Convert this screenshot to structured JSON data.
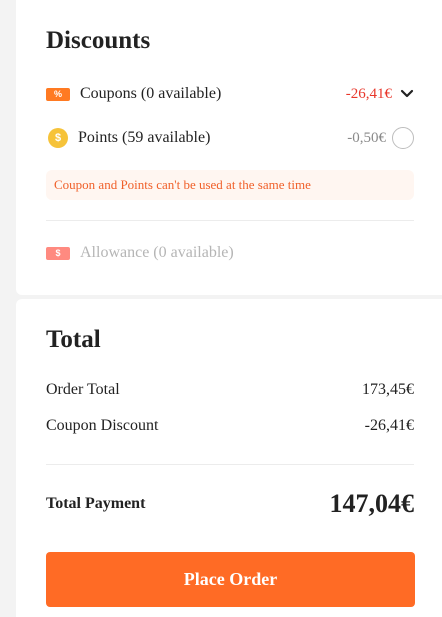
{
  "discounts": {
    "title": "Discounts",
    "coupons": {
      "icon_text": "%",
      "label": "Coupons (0 available)",
      "amount": "-26,41€",
      "amount_color": "#e8362a"
    },
    "points": {
      "icon_text": "$",
      "label": "Points (59 available)",
      "amount": "-0,50€"
    },
    "warning": "Coupon and Points can't be used at the same time",
    "allowance": {
      "icon_text": "$",
      "label": "Allowance (0 available)"
    }
  },
  "total": {
    "title": "Total",
    "order_total_label": "Order Total",
    "order_total_value": "173,45€",
    "coupon_discount_label": "Coupon Discount",
    "coupon_discount_value": "-26,41€",
    "total_payment_label": "Total Payment",
    "total_payment_value": "147,04€",
    "place_order_label": "Place Order"
  }
}
